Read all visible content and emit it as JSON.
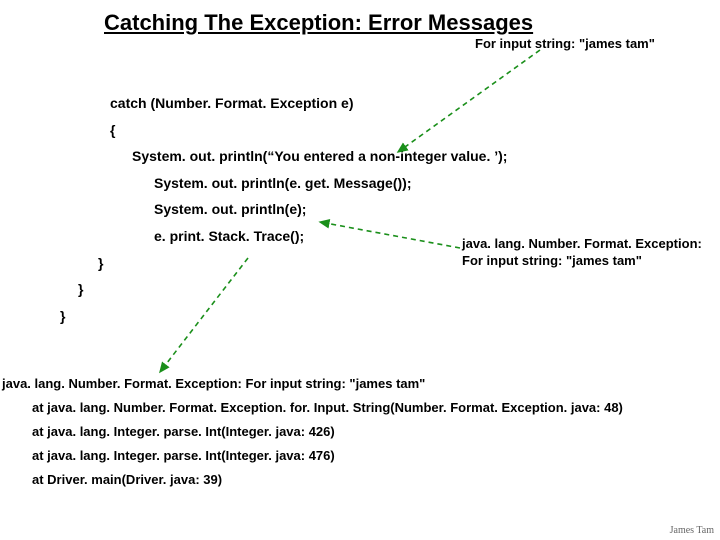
{
  "title": "Catching The Exception: Error Messages",
  "top_note": "For input string: \"james tam\"",
  "code": {
    "l1": "catch (Number. Format. Exception e)",
    "l2": "{",
    "l3": "System. out. println(“You entered a non-integer value. ’);",
    "l4": "System. out. println(e. get. Message());",
    "l5": "System. out. println(e);",
    "l6": "e. print. Stack. Trace();",
    "c3": "}",
    "c4": "}",
    "c5": "}"
  },
  "side": {
    "s1": "java. lang. Number. Format. Exception:",
    "s2": "For input string: \"james tam\""
  },
  "trace": {
    "t0": "java. lang. Number. Format. Exception: For input string: \"james tam\"",
    "t1": "at java. lang. Number. Format. Exception. for. Input. String(Number. Format. Exception. java: 48)",
    "t2": "at java. lang. Integer. parse. Int(Integer. java: 426)",
    "t3": "at java. lang. Integer. parse. Int(Integer. java: 476)",
    "t4": "at Driver. main(Driver. java: 39)"
  },
  "footer": "James Tam"
}
